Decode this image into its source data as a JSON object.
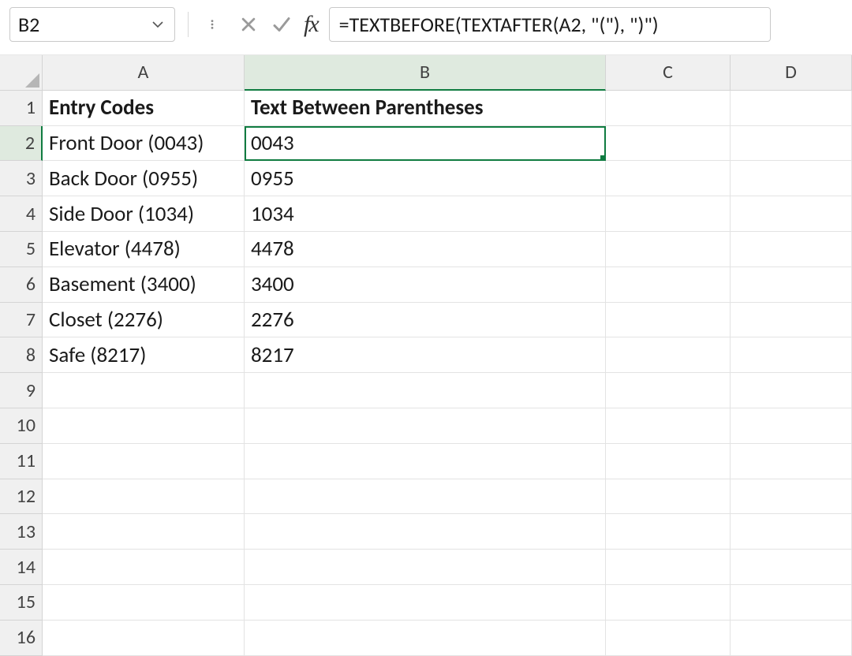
{
  "nameBox": {
    "value": "B2"
  },
  "formulaBar": {
    "value": "=TEXTBEFORE(TEXTAFTER(A2, \"(\"), \")\")"
  },
  "columns": [
    "A",
    "B",
    "C",
    "D"
  ],
  "rowCount": 16,
  "selection": {
    "cell": "B2",
    "colIndex": 1,
    "rowIndex": 1
  },
  "headers": {
    "A": "Entry Codes",
    "B": "Text Between Parentheses"
  },
  "data": [
    {
      "A": "Front Door (0043)",
      "B": "0043"
    },
    {
      "A": "Back Door (0955)",
      "B": "0955"
    },
    {
      "A": "Side Door (1034)",
      "B": "1034"
    },
    {
      "A": "Elevator (4478)",
      "B": "4478"
    },
    {
      "A": "Basement (3400)",
      "B": "3400"
    },
    {
      "A": "Closet (2276)",
      "B": "2276"
    },
    {
      "A": "Safe (8217)",
      "B": "8217"
    }
  ]
}
